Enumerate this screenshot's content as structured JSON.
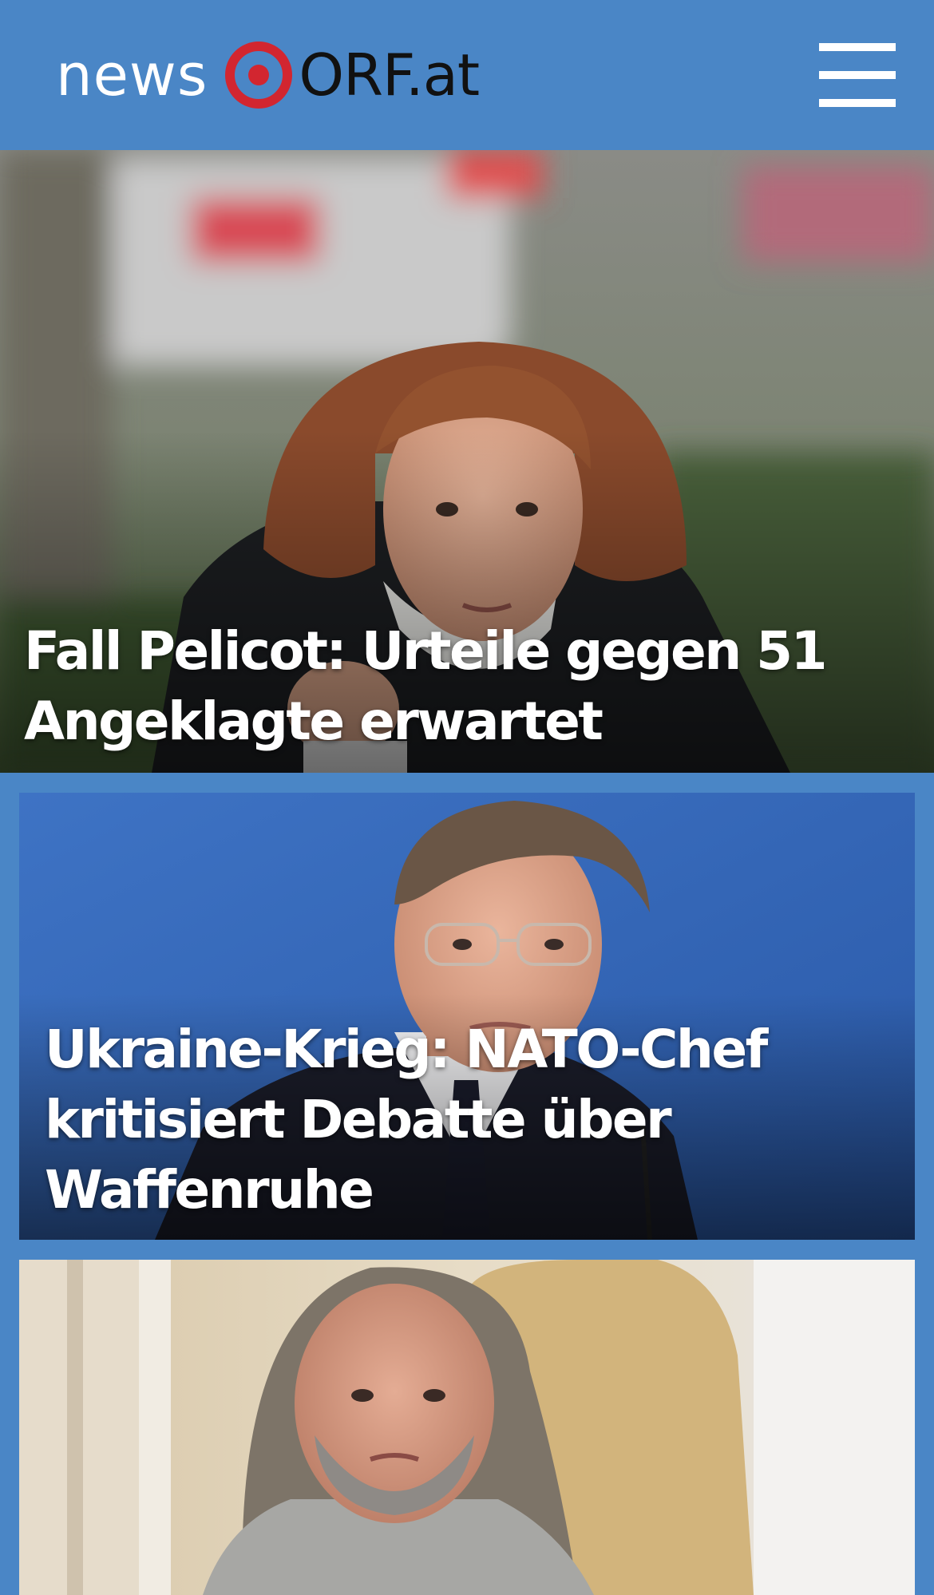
{
  "header": {
    "logo_news": "news",
    "logo_orf": "ORF.at",
    "logo_icon": "orf-target-icon",
    "menu_icon": "hamburger-menu-icon"
  },
  "colors": {
    "header_bg": "#4a86c6",
    "logo_red": "#d22630",
    "logo_dark": "#111111",
    "headline_text": "#ffffff"
  },
  "stories": [
    {
      "headline": "Fall Pelicot: Urteile gegen 51 Angeklagte erwartet"
    },
    {
      "headline": "Ukraine-Krieg: NATO-Chef kritisiert Debatte über Waffenruhe"
    },
    {
      "headline": ""
    }
  ]
}
